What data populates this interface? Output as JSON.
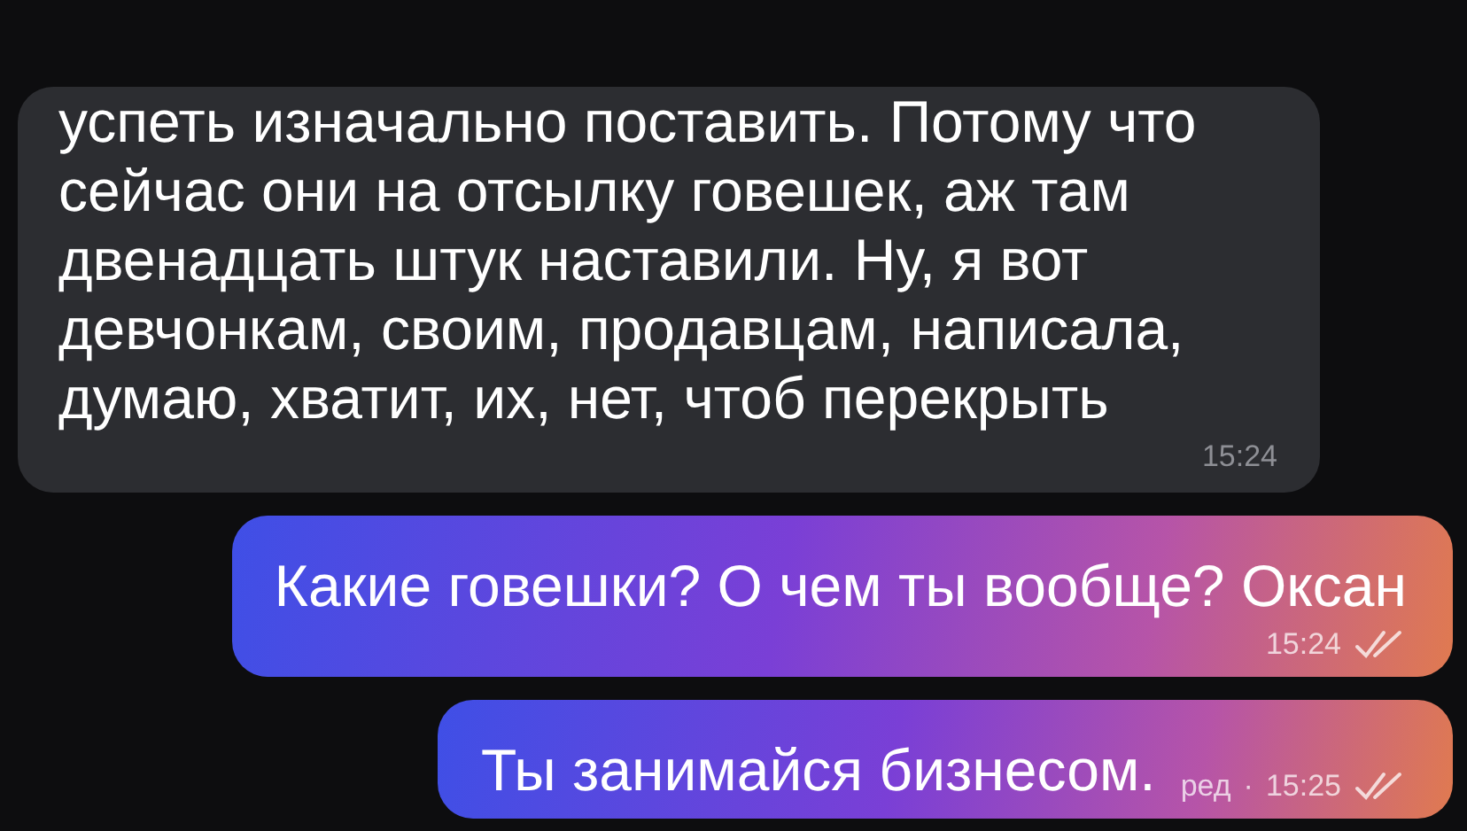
{
  "messages": [
    {
      "kind": "incoming",
      "text": "успеть изначально поставить. Потому что\nсейчас они на отсылку говешек, аж там\nдвенадцать штук наставили. Ну, я вот\nдевчонкам, своим, продавцам, написала,\nдумаю, хватит, их, нет, чтоб перекрыть",
      "time": "15:24"
    },
    {
      "kind": "outgoing",
      "text": "Какие говешки? О чем ты вообще? Оксан",
      "time": "15:24",
      "read": true
    },
    {
      "kind": "outgoing",
      "text": "Ты занимайся бизнесом.",
      "edited": "ред",
      "separator": "·",
      "time": "15:25",
      "read": true
    }
  ]
}
